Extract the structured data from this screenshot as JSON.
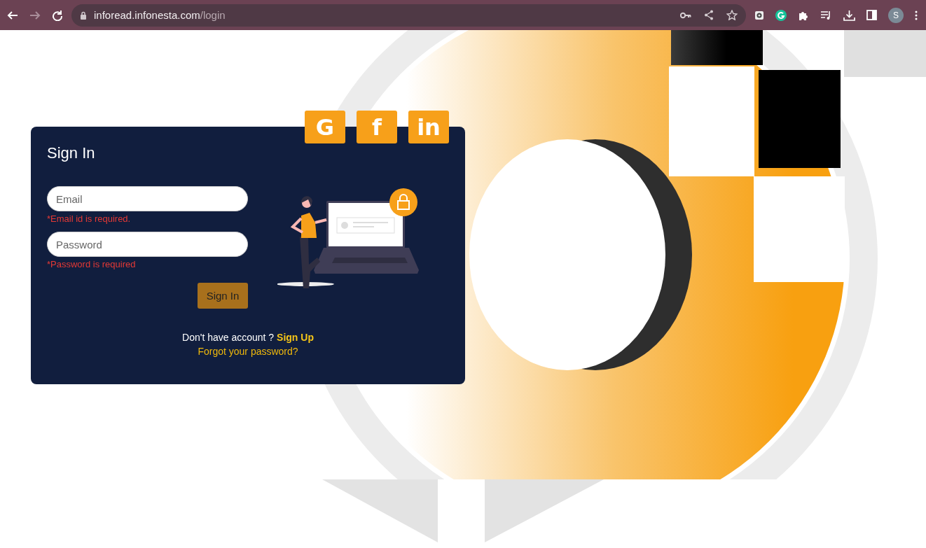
{
  "browser": {
    "nav": [
      {
        "kind": "back",
        "disabled": false
      },
      {
        "kind": "forward",
        "disabled": true
      },
      {
        "kind": "reload",
        "disabled": false
      }
    ],
    "url_host": "inforead.infonesta.com",
    "url_path": "/login",
    "avatar": "S"
  },
  "social_buttons": [
    {
      "label": "G"
    },
    {
      "label": "f"
    },
    {
      "label": "in"
    }
  ],
  "title": "Sign In",
  "fields": [
    {
      "placeholder": "Email",
      "error": "*Email id is required."
    },
    {
      "placeholder": "Password",
      "error": "*Password is required"
    }
  ],
  "submit": "Sign In",
  "signup_prompt": "Don't have account ?",
  "signup_link": "Sign Up",
  "forgot_link": "Forgot your password?"
}
